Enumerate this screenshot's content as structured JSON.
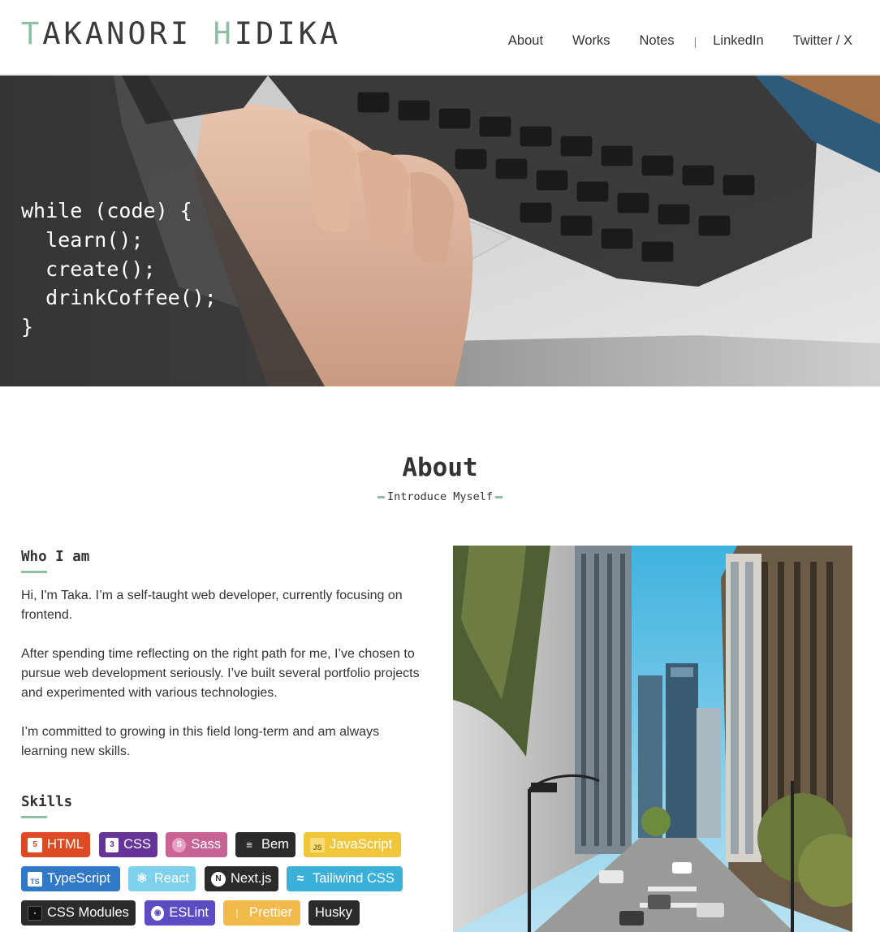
{
  "header": {
    "logo_initial_1": "T",
    "logo_rest_1": "AKANORI",
    "logo_initial_2": "H",
    "logo_rest_2": "IDIKA",
    "nav": [
      "About",
      "Works",
      "Notes",
      "LinkedIn",
      "Twitter / X"
    ],
    "separator": "|"
  },
  "hero": {
    "code_lines": [
      "while (code) {",
      "  learn();",
      "  create();",
      "  drinkCoffee();",
      "}"
    ]
  },
  "about": {
    "title": "About",
    "subtitle": "Introduce Myself",
    "who_title": "Who I am",
    "paragraphs": [
      "Hi, I'm Taka. I’m a self-taught web developer, currently focusing on frontend.",
      "After spending time reflecting on the right path for me, I’ve chosen to pursue web development seriously. I’ve built several portfolio projects and experimented with various technologies.",
      "I’m committed to growing in this field long-term and am always learning new skills."
    ],
    "skills_title": "Skills",
    "skills": [
      "HTML",
      "CSS",
      "Sass",
      "Bem",
      "JavaScript",
      "TypeScript",
      "React",
      "Next.js",
      "Tailiwind CSS",
      "CSS Modules",
      "ESLint",
      "Prettier",
      "Husky"
    ]
  },
  "colors": {
    "accent": "#8cc2a2",
    "html": "#dd4b25",
    "css": "#663399",
    "sass": "#c76395",
    "bem": "#2b2b2b",
    "javascript": "#f0c63a",
    "typescript": "#3178c6",
    "react": "#7fd0ec",
    "nextjs": "#2b2b2b",
    "tailwind": "#3bb0d8",
    "cssmodules": "#2b2b2b",
    "eslint": "#5b4cc4",
    "prettier": "#f2b94b",
    "husky": "#2b2b2b"
  }
}
